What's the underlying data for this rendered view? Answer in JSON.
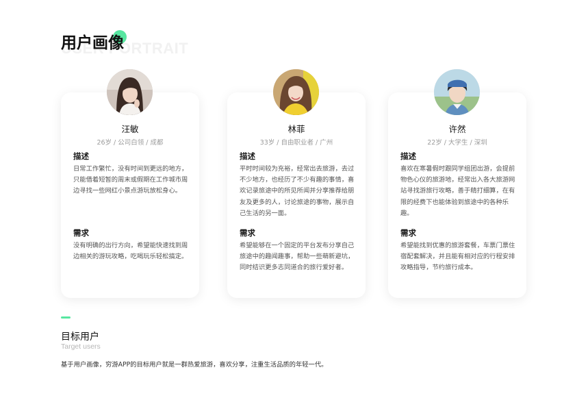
{
  "header": {
    "title": "用户画像",
    "subtitle_en": "USER PORTRAIT",
    "accent_color": "#57e6a0"
  },
  "cards": [
    {
      "name": "汪敏",
      "meta": "26岁 / 公司白领 / 成都",
      "desc_title": "描述",
      "desc": "日常工作繁忙，没有时间到更远的地方，只能借着短暂的周末或假期在工作城市周边寻找一些网红小景点游玩放松身心。",
      "need_title": "需求",
      "need": "没有明确的出行方向，希望能快速找到周边相关的游玩攻略，吃喝玩乐轻松搞定。"
    },
    {
      "name": "林菲",
      "meta": "33岁 / 自由职业者 / 广州",
      "desc_title": "描述",
      "desc": "平时时间较为充裕，经常出去旅游，去过不少地方，也经历了不少有趣的事情，喜欢记录旅途中的所见所闻并分享推荐给朋友及更多的人，讨论旅途的事物，展示自己生活的另一面。",
      "need_title": "需求",
      "need": "希望能够在一个固定的平台发布分享自己旅途中的趣闻趣事，帮助一些萌新避坑，同时结识更多志同道合的旅行爱好者。"
    },
    {
      "name": "许然",
      "meta": "22岁 / 大学生 / 深圳",
      "desc_title": "描述",
      "desc": "喜欢在寒暑假时跟同学组团出游，会提前物色心仪的旅游地，经常出入各大旅游网站寻找游旅行攻略，善于精打细算，在有限的经费下也能体验到旅途中的各种乐趣。",
      "need_title": "需求",
      "need": "希望能找到优惠的旅游套餐，车票门票住宿配套解决，并且能有相对应的行程安排攻略指导，节约旅行成本。"
    }
  ],
  "target": {
    "title": "目标用户",
    "subtitle": "Target users",
    "desc": "基于用户画像，穷游APP的目标用户就是一群热爱旅游，喜欢分享，注重生活品质的年轻一代。"
  }
}
